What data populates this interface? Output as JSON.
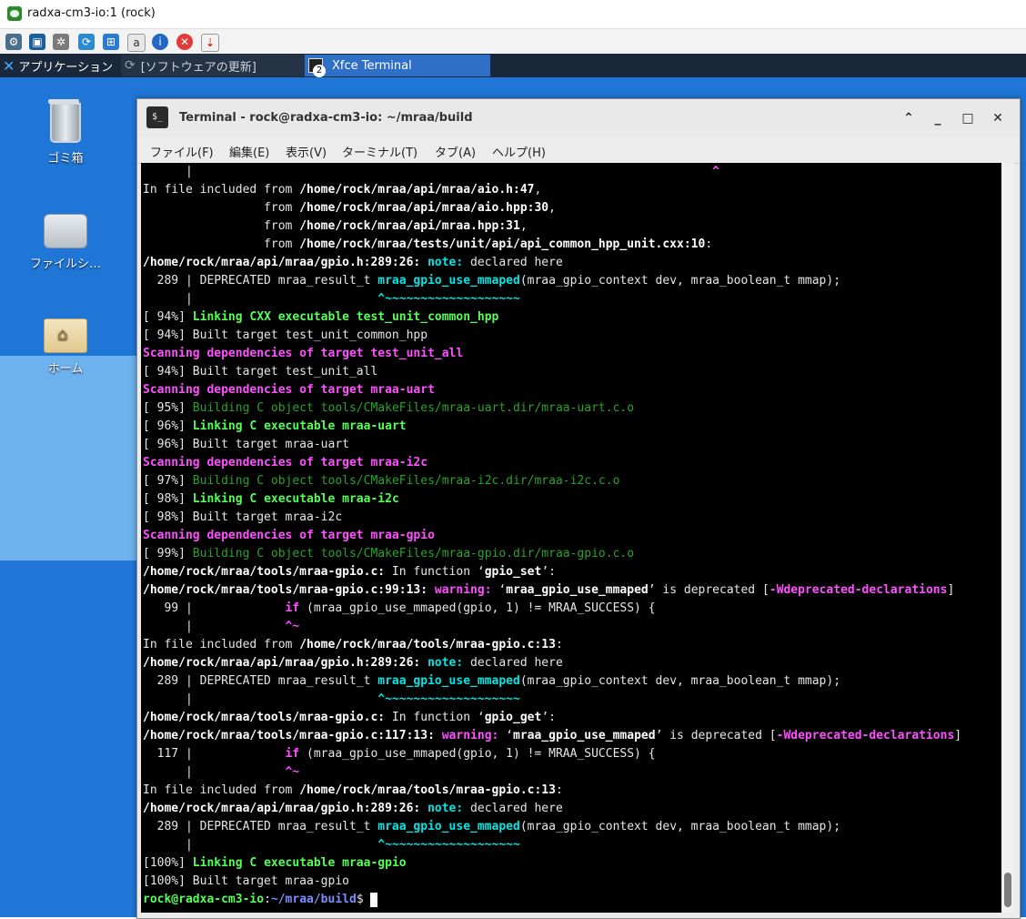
{
  "vnc": {
    "title": "radxa-cm3-io:1 (rock)",
    "toolbar_icons": [
      "options-icon",
      "fullscreen-icon",
      "settings-icon",
      "refresh-icon",
      "windows-key-icon",
      "ctrl-alt-del-icon",
      "info-icon",
      "disconnect-icon",
      "transfer-icon"
    ]
  },
  "panel": {
    "app_menu": "アプリケーション",
    "tasks": [
      {
        "label": "[ソフトウェアの更新]",
        "icon": "refresh-icon"
      },
      {
        "label": "Xfce Terminal",
        "icon": "terminal-icon",
        "badge": "2"
      }
    ]
  },
  "desktop": {
    "icons": [
      {
        "label": "ゴミ箱",
        "icon": "trash-icon"
      },
      {
        "label": "ファイルシ…",
        "icon": "drive-icon"
      },
      {
        "label": "ホーム",
        "icon": "home-folder-icon"
      }
    ]
  },
  "terminal": {
    "title": "Terminal - rock@radxa-cm3-io: ~/mraa/build",
    "menu": [
      "ファイル(F)",
      "編集(E)",
      "表示(V)",
      "ターミナル(T)",
      "タブ(A)",
      "ヘルプ(H)"
    ],
    "prompt": {
      "user": "rock@radxa-cm3-io",
      "path": "~/mraa/build",
      "symbol": "$"
    },
    "lines": [
      [
        {
          "t": "      |                                                                         ",
          "s": "n"
        },
        {
          "t": "^",
          "s": "m"
        }
      ],
      [
        {
          "t": "In file included from ",
          "s": "n"
        },
        {
          "t": "/home/rock/mraa/api/mraa/aio.h:47",
          "s": "w"
        },
        {
          "t": ",",
          "s": "n"
        }
      ],
      [
        {
          "t": "                 from ",
          "s": "n"
        },
        {
          "t": "/home/rock/mraa/api/mraa/aio.hpp:30",
          "s": "w"
        },
        {
          "t": ",",
          "s": "n"
        }
      ],
      [
        {
          "t": "                 from ",
          "s": "n"
        },
        {
          "t": "/home/rock/mraa/api/mraa.hpp:31",
          "s": "w"
        },
        {
          "t": ",",
          "s": "n"
        }
      ],
      [
        {
          "t": "                 from ",
          "s": "n"
        },
        {
          "t": "/home/rock/mraa/tests/unit/api/api_common_hpp_unit.cxx:10",
          "s": "w"
        },
        {
          "t": ":",
          "s": "n"
        }
      ],
      [
        {
          "t": "/home/rock/mraa/api/mraa/gpio.h:289:26: ",
          "s": "w"
        },
        {
          "t": "note:",
          "s": "c"
        },
        {
          "t": " declared here",
          "s": "n"
        }
      ],
      [
        {
          "t": "  289 | DEPRECATED mraa_result_t ",
          "s": "n"
        },
        {
          "t": "mraa_gpio_use_mmaped",
          "s": "c"
        },
        {
          "t": "(mraa_gpio_context dev, mraa_boolean_t mmap);",
          "s": "n"
        }
      ],
      [
        {
          "t": "      |                          ",
          "s": "n"
        },
        {
          "t": "^~~~~~~~~~~~~~~~~~~~",
          "s": "c"
        }
      ],
      [
        {
          "t": "[ 94%] ",
          "s": "n"
        },
        {
          "t": "Linking CXX executable test_unit_common_hpp",
          "s": "G"
        }
      ],
      [
        {
          "t": "[ 94%] Built target test_unit_common_hpp",
          "s": "n"
        }
      ],
      [
        {
          "t": "Scanning dependencies of target test_unit_all",
          "s": "m"
        }
      ],
      [
        {
          "t": "[ 94%] Built target test_unit_all",
          "s": "n"
        }
      ],
      [
        {
          "t": "Scanning dependencies of target mraa-uart",
          "s": "m"
        }
      ],
      [
        {
          "t": "[ 95%] ",
          "s": "n"
        },
        {
          "t": "Building C object tools/CMakeFiles/mraa-uart.dir/mraa-uart.c.o",
          "s": "g"
        }
      ],
      [
        {
          "t": "[ 96%] ",
          "s": "n"
        },
        {
          "t": "Linking C executable mraa-uart",
          "s": "G"
        }
      ],
      [
        {
          "t": "[ 96%] Built target mraa-uart",
          "s": "n"
        }
      ],
      [
        {
          "t": "Scanning dependencies of target mraa-i2c",
          "s": "m"
        }
      ],
      [
        {
          "t": "[ 97%] ",
          "s": "n"
        },
        {
          "t": "Building C object tools/CMakeFiles/mraa-i2c.dir/mraa-i2c.c.o",
          "s": "g"
        }
      ],
      [
        {
          "t": "[ 98%] ",
          "s": "n"
        },
        {
          "t": "Linking C executable mraa-i2c",
          "s": "G"
        }
      ],
      [
        {
          "t": "[ 98%] Built target mraa-i2c",
          "s": "n"
        }
      ],
      [
        {
          "t": "Scanning dependencies of target mraa-gpio",
          "s": "m"
        }
      ],
      [
        {
          "t": "[ 99%] ",
          "s": "n"
        },
        {
          "t": "Building C object tools/CMakeFiles/mraa-gpio.dir/mraa-gpio.c.o",
          "s": "g"
        }
      ],
      [
        {
          "t": "/home/rock/mraa/tools/mraa-gpio.c:",
          "s": "w"
        },
        {
          "t": " In function ‘",
          "s": "n"
        },
        {
          "t": "gpio_set",
          "s": "w"
        },
        {
          "t": "’:",
          "s": "n"
        }
      ],
      [
        {
          "t": "/home/rock/mraa/tools/mraa-gpio.c:99:13: ",
          "s": "w"
        },
        {
          "t": "warning:",
          "s": "m"
        },
        {
          "t": " ‘",
          "s": "n"
        },
        {
          "t": "mraa_gpio_use_mmaped",
          "s": "w"
        },
        {
          "t": "’ is deprecated [",
          "s": "n"
        },
        {
          "t": "-Wdeprecated-declarations",
          "s": "m"
        },
        {
          "t": "]",
          "s": "n"
        }
      ],
      [
        {
          "t": "   99 |             ",
          "s": "n"
        },
        {
          "t": "if",
          "s": "m"
        },
        {
          "t": " (mraa_gpio_use_mmaped(gpio, 1) != MRAA_SUCCESS) {",
          "s": "n"
        }
      ],
      [
        {
          "t": "      |             ",
          "s": "n"
        },
        {
          "t": "^~",
          "s": "m"
        }
      ],
      [
        {
          "t": "In file included from ",
          "s": "n"
        },
        {
          "t": "/home/rock/mraa/tools/mraa-gpio.c:13",
          "s": "w"
        },
        {
          "t": ":",
          "s": "n"
        }
      ],
      [
        {
          "t": "/home/rock/mraa/api/mraa/gpio.h:289:26: ",
          "s": "w"
        },
        {
          "t": "note:",
          "s": "c"
        },
        {
          "t": " declared here",
          "s": "n"
        }
      ],
      [
        {
          "t": "  289 | DEPRECATED mraa_result_t ",
          "s": "n"
        },
        {
          "t": "mraa_gpio_use_mmaped",
          "s": "c"
        },
        {
          "t": "(mraa_gpio_context dev, mraa_boolean_t mmap);",
          "s": "n"
        }
      ],
      [
        {
          "t": "      |                          ",
          "s": "n"
        },
        {
          "t": "^~~~~~~~~~~~~~~~~~~~",
          "s": "c"
        }
      ],
      [
        {
          "t": "/home/rock/mraa/tools/mraa-gpio.c:",
          "s": "w"
        },
        {
          "t": " In function ‘",
          "s": "n"
        },
        {
          "t": "gpio_get",
          "s": "w"
        },
        {
          "t": "’:",
          "s": "n"
        }
      ],
      [
        {
          "t": "/home/rock/mraa/tools/mraa-gpio.c:117:13: ",
          "s": "w"
        },
        {
          "t": "warning:",
          "s": "m"
        },
        {
          "t": " ‘",
          "s": "n"
        },
        {
          "t": "mraa_gpio_use_mmaped",
          "s": "w"
        },
        {
          "t": "’ is deprecated [",
          "s": "n"
        },
        {
          "t": "-Wdeprecated-declarations",
          "s": "m"
        },
        {
          "t": "]",
          "s": "n"
        }
      ],
      [
        {
          "t": "  117 |             ",
          "s": "n"
        },
        {
          "t": "if",
          "s": "m"
        },
        {
          "t": " (mraa_gpio_use_mmaped(gpio, 1) != MRAA_SUCCESS) {",
          "s": "n"
        }
      ],
      [
        {
          "t": "      |             ",
          "s": "n"
        },
        {
          "t": "^~",
          "s": "m"
        }
      ],
      [
        {
          "t": "In file included from ",
          "s": "n"
        },
        {
          "t": "/home/rock/mraa/tools/mraa-gpio.c:13",
          "s": "w"
        },
        {
          "t": ":",
          "s": "n"
        }
      ],
      [
        {
          "t": "/home/rock/mraa/api/mraa/gpio.h:289:26: ",
          "s": "w"
        },
        {
          "t": "note:",
          "s": "c"
        },
        {
          "t": " declared here",
          "s": "n"
        }
      ],
      [
        {
          "t": "  289 | DEPRECATED mraa_result_t ",
          "s": "n"
        },
        {
          "t": "mraa_gpio_use_mmaped",
          "s": "c"
        },
        {
          "t": "(mraa_gpio_context dev, mraa_boolean_t mmap);",
          "s": "n"
        }
      ],
      [
        {
          "t": "      |                          ",
          "s": "n"
        },
        {
          "t": "^~~~~~~~~~~~~~~~~~~~",
          "s": "c"
        }
      ],
      [
        {
          "t": "[100%] ",
          "s": "n"
        },
        {
          "t": "Linking C executable mraa-gpio",
          "s": "G"
        }
      ],
      [
        {
          "t": "[100%] Built target mraa-gpio",
          "s": "n"
        }
      ]
    ]
  },
  "colors": {
    "desktop": "#1f76d6",
    "panel": "#19283a",
    "active_task": "#2f6fc6",
    "terminal_bg": "#000000"
  }
}
